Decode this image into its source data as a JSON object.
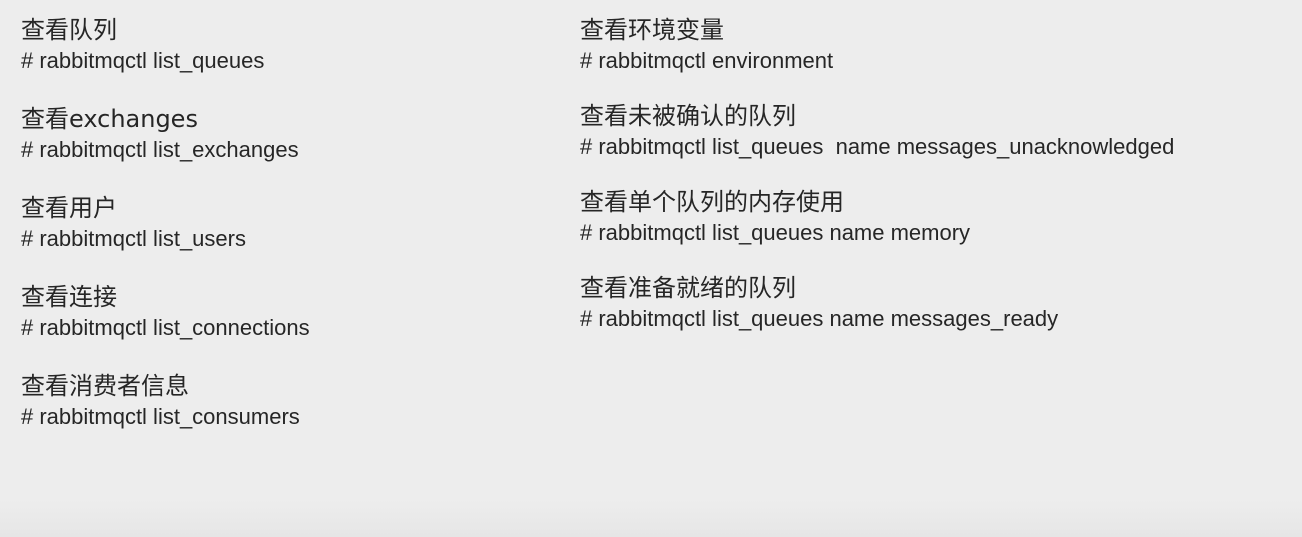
{
  "left_column": [
    {
      "title": "查看队列",
      "command": "# rabbitmqctl list_queues"
    },
    {
      "title": "查看exchanges",
      "command": "# rabbitmqctl list_exchanges"
    },
    {
      "title": "查看用户",
      "command": "# rabbitmqctl list_users"
    },
    {
      "title": "查看连接",
      "command": "# rabbitmqctl list_connections"
    },
    {
      "title": "查看消费者信息",
      "command": "# rabbitmqctl list_consumers"
    }
  ],
  "right_column": [
    {
      "title": "查看环境变量",
      "command": "# rabbitmqctl environment"
    },
    {
      "title": "查看未被确认的队列",
      "command": "# rabbitmqctl list_queues  name messages_unacknowledged"
    },
    {
      "title": "查看单个队列的内存使用",
      "command": "# rabbitmqctl list_queues name memory"
    },
    {
      "title": "查看准备就绪的队列",
      "command": "# rabbitmqctl list_queues name messages_ready"
    }
  ]
}
